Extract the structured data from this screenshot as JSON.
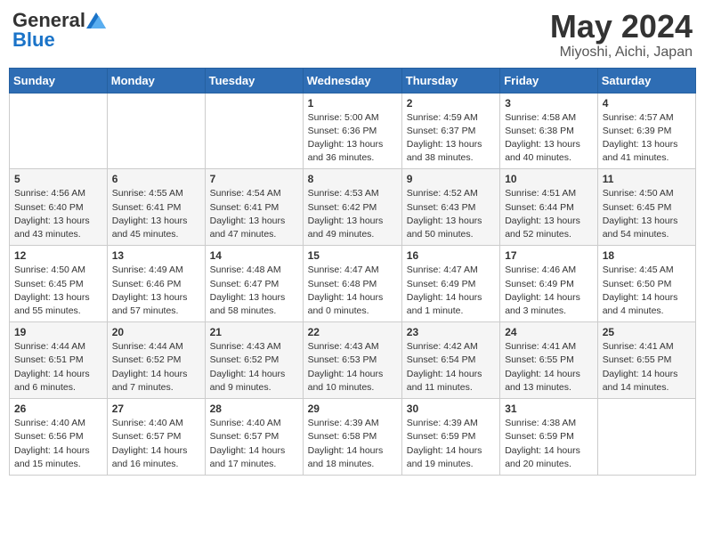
{
  "header": {
    "logo_general": "General",
    "logo_blue": "Blue",
    "title": "May 2024",
    "subtitle": "Miyoshi, Aichi, Japan"
  },
  "days_of_week": [
    "Sunday",
    "Monday",
    "Tuesday",
    "Wednesday",
    "Thursday",
    "Friday",
    "Saturday"
  ],
  "weeks": [
    [
      {
        "day": "",
        "info": ""
      },
      {
        "day": "",
        "info": ""
      },
      {
        "day": "",
        "info": ""
      },
      {
        "day": "1",
        "info": "Sunrise: 5:00 AM\nSunset: 6:36 PM\nDaylight: 13 hours\nand 36 minutes."
      },
      {
        "day": "2",
        "info": "Sunrise: 4:59 AM\nSunset: 6:37 PM\nDaylight: 13 hours\nand 38 minutes."
      },
      {
        "day": "3",
        "info": "Sunrise: 4:58 AM\nSunset: 6:38 PM\nDaylight: 13 hours\nand 40 minutes."
      },
      {
        "day": "4",
        "info": "Sunrise: 4:57 AM\nSunset: 6:39 PM\nDaylight: 13 hours\nand 41 minutes."
      }
    ],
    [
      {
        "day": "5",
        "info": "Sunrise: 4:56 AM\nSunset: 6:40 PM\nDaylight: 13 hours\nand 43 minutes."
      },
      {
        "day": "6",
        "info": "Sunrise: 4:55 AM\nSunset: 6:41 PM\nDaylight: 13 hours\nand 45 minutes."
      },
      {
        "day": "7",
        "info": "Sunrise: 4:54 AM\nSunset: 6:41 PM\nDaylight: 13 hours\nand 47 minutes."
      },
      {
        "day": "8",
        "info": "Sunrise: 4:53 AM\nSunset: 6:42 PM\nDaylight: 13 hours\nand 49 minutes."
      },
      {
        "day": "9",
        "info": "Sunrise: 4:52 AM\nSunset: 6:43 PM\nDaylight: 13 hours\nand 50 minutes."
      },
      {
        "day": "10",
        "info": "Sunrise: 4:51 AM\nSunset: 6:44 PM\nDaylight: 13 hours\nand 52 minutes."
      },
      {
        "day": "11",
        "info": "Sunrise: 4:50 AM\nSunset: 6:45 PM\nDaylight: 13 hours\nand 54 minutes."
      }
    ],
    [
      {
        "day": "12",
        "info": "Sunrise: 4:50 AM\nSunset: 6:45 PM\nDaylight: 13 hours\nand 55 minutes."
      },
      {
        "day": "13",
        "info": "Sunrise: 4:49 AM\nSunset: 6:46 PM\nDaylight: 13 hours\nand 57 minutes."
      },
      {
        "day": "14",
        "info": "Sunrise: 4:48 AM\nSunset: 6:47 PM\nDaylight: 13 hours\nand 58 minutes."
      },
      {
        "day": "15",
        "info": "Sunrise: 4:47 AM\nSunset: 6:48 PM\nDaylight: 14 hours\nand 0 minutes."
      },
      {
        "day": "16",
        "info": "Sunrise: 4:47 AM\nSunset: 6:49 PM\nDaylight: 14 hours\nand 1 minute."
      },
      {
        "day": "17",
        "info": "Sunrise: 4:46 AM\nSunset: 6:49 PM\nDaylight: 14 hours\nand 3 minutes."
      },
      {
        "day": "18",
        "info": "Sunrise: 4:45 AM\nSunset: 6:50 PM\nDaylight: 14 hours\nand 4 minutes."
      }
    ],
    [
      {
        "day": "19",
        "info": "Sunrise: 4:44 AM\nSunset: 6:51 PM\nDaylight: 14 hours\nand 6 minutes."
      },
      {
        "day": "20",
        "info": "Sunrise: 4:44 AM\nSunset: 6:52 PM\nDaylight: 14 hours\nand 7 minutes."
      },
      {
        "day": "21",
        "info": "Sunrise: 4:43 AM\nSunset: 6:52 PM\nDaylight: 14 hours\nand 9 minutes."
      },
      {
        "day": "22",
        "info": "Sunrise: 4:43 AM\nSunset: 6:53 PM\nDaylight: 14 hours\nand 10 minutes."
      },
      {
        "day": "23",
        "info": "Sunrise: 4:42 AM\nSunset: 6:54 PM\nDaylight: 14 hours\nand 11 minutes."
      },
      {
        "day": "24",
        "info": "Sunrise: 4:41 AM\nSunset: 6:55 PM\nDaylight: 14 hours\nand 13 minutes."
      },
      {
        "day": "25",
        "info": "Sunrise: 4:41 AM\nSunset: 6:55 PM\nDaylight: 14 hours\nand 14 minutes."
      }
    ],
    [
      {
        "day": "26",
        "info": "Sunrise: 4:40 AM\nSunset: 6:56 PM\nDaylight: 14 hours\nand 15 minutes."
      },
      {
        "day": "27",
        "info": "Sunrise: 4:40 AM\nSunset: 6:57 PM\nDaylight: 14 hours\nand 16 minutes."
      },
      {
        "day": "28",
        "info": "Sunrise: 4:40 AM\nSunset: 6:57 PM\nDaylight: 14 hours\nand 17 minutes."
      },
      {
        "day": "29",
        "info": "Sunrise: 4:39 AM\nSunset: 6:58 PM\nDaylight: 14 hours\nand 18 minutes."
      },
      {
        "day": "30",
        "info": "Sunrise: 4:39 AM\nSunset: 6:59 PM\nDaylight: 14 hours\nand 19 minutes."
      },
      {
        "day": "31",
        "info": "Sunrise: 4:38 AM\nSunset: 6:59 PM\nDaylight: 14 hours\nand 20 minutes."
      },
      {
        "day": "",
        "info": ""
      }
    ]
  ]
}
